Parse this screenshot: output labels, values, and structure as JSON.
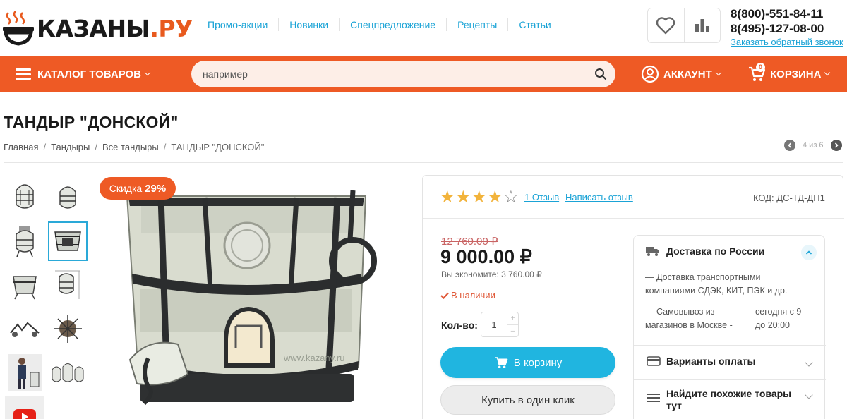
{
  "brand": {
    "name_main": "КАЗАНЫ",
    "name_dot": ".",
    "name_tld": "РУ"
  },
  "topnav": [
    {
      "label": "Промо-акции"
    },
    {
      "label": "Новинки"
    },
    {
      "label": "Спецпредложение"
    },
    {
      "label": "Рецепты"
    },
    {
      "label": "Статьи"
    }
  ],
  "contacts": {
    "phone1": "8(800)-551-84-11",
    "phone2": "8(495)-127-08-00",
    "callback": "Заказать обратный звонок"
  },
  "navbar": {
    "catalog_label": "КАТАЛОГ ТОВАРОВ",
    "search_placeholder": "например",
    "account_label": "АККАУНТ",
    "cart_label": "КОРЗИНА",
    "cart_count": "0"
  },
  "product": {
    "title": "ТАНДЫР \"ДОНСКОЙ\"",
    "breadcrumbs": [
      "Главная",
      "Тандыры",
      "Все тандыры",
      "ТАНДЫР \"ДОНСКОЙ\""
    ],
    "pager": "4 из 6",
    "discount_label": "Скидка",
    "discount_value": "29%",
    "watermark": "www.kazany.ru",
    "rating": 4,
    "rating_max": 5,
    "reviews_link": "1 Отзыв",
    "write_review": "Написать отзыв",
    "code": "КОД: ДС-ТД-ДН1",
    "old_price": "12 760.00 ₽",
    "price": "9 000.00 ₽",
    "savings": "Вы экономите: 3 760.00 ₽",
    "stock": "В наличии",
    "qty_label": "Кол-во:",
    "qty_value": "1",
    "add_to_cart": "В корзину",
    "buy_one_click": "Купить в один клик"
  },
  "delivery": {
    "title": "Доставка по России",
    "line1": "— Доставка транспортными",
    "line2": "компаниями СДЭК, КИТ, ПЭК и др.",
    "pickup_a1": "— Самовывоз из",
    "pickup_a2": "магазинов в Москве -",
    "pickup_b1": "сегодня с 9",
    "pickup_b2": "до 20:00",
    "payment": "Варианты оплаты",
    "similar_1": "Найдите похожие товары",
    "similar_2": "тут"
  },
  "colors": {
    "accent": "#ee5a25",
    "link": "#1aa3d6",
    "button": "#20b5e0",
    "star": "#f2b33b"
  },
  "icons": [
    "steam-logo-icon",
    "heart-icon",
    "compare-chart-icon",
    "burger-icon",
    "search-icon",
    "user-icon",
    "cart-icon",
    "chevron-left-icon",
    "chevron-right-icon",
    "check-icon",
    "truck-icon",
    "card-icon",
    "list-icon",
    "youtube-icon"
  ]
}
